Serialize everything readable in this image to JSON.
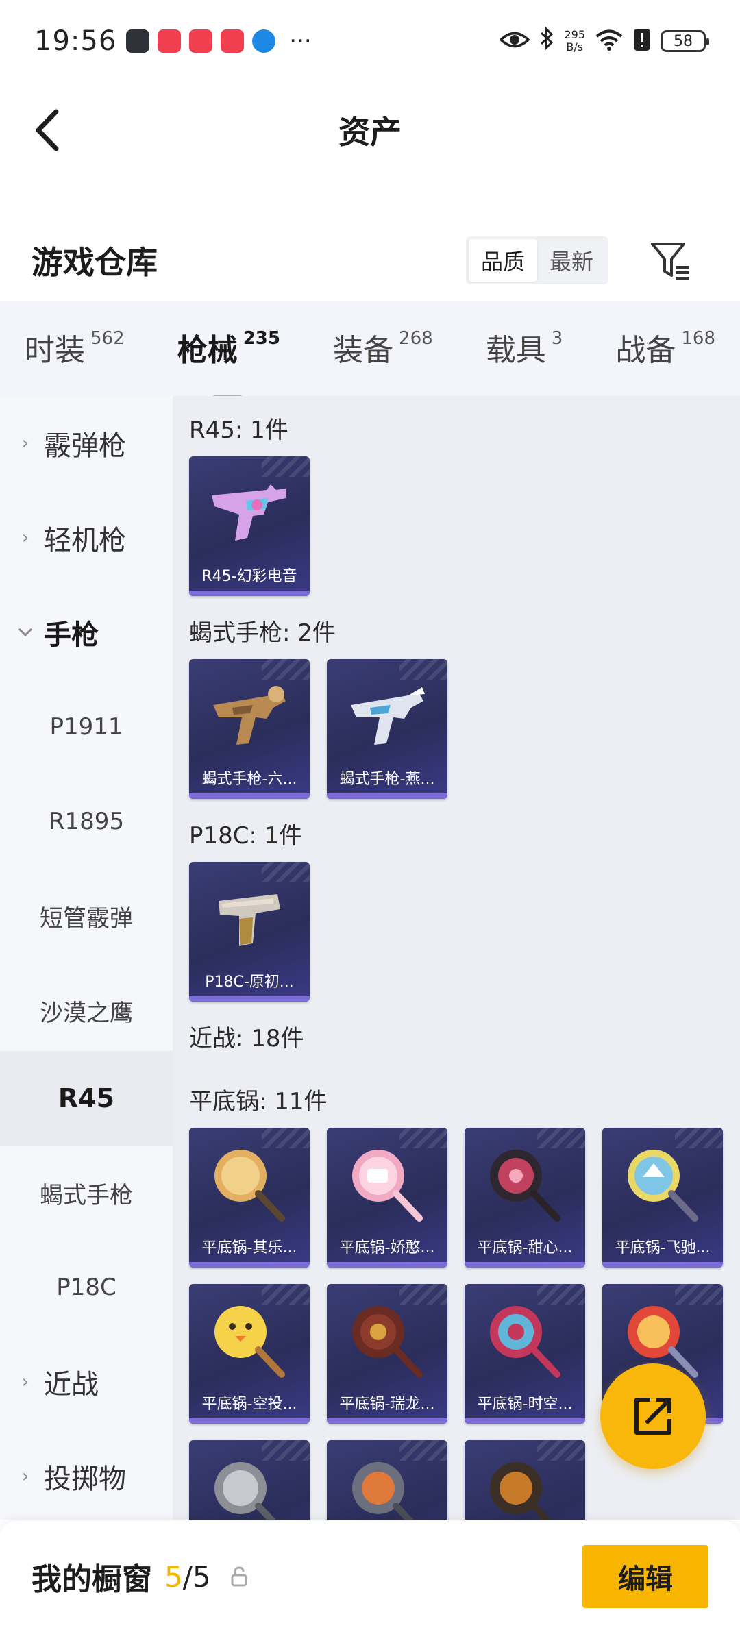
{
  "status_bar": {
    "time": "19:56",
    "more": "···",
    "net_rate_value": "295",
    "net_rate_unit": "B/s",
    "battery": "58"
  },
  "header": {
    "title": "资产"
  },
  "warehouse": {
    "title": "游戏仓库",
    "sort_options": [
      "品质",
      "最新"
    ],
    "active_sort": "品质"
  },
  "category_tabs": [
    {
      "name": "时装",
      "count": "562"
    },
    {
      "name": "枪械",
      "count": "235"
    },
    {
      "name": "装备",
      "count": "268"
    },
    {
      "name": "载具",
      "count": "3"
    },
    {
      "name": "战备",
      "count": "168"
    }
  ],
  "active_category": "枪械",
  "sidebar": {
    "items": [
      {
        "label": "霰弹枪",
        "type": "group"
      },
      {
        "label": "轻机枪",
        "type": "group"
      },
      {
        "label": "手枪",
        "type": "group",
        "expanded": true
      },
      {
        "label": "P1911",
        "type": "sub"
      },
      {
        "label": "R1895",
        "type": "sub"
      },
      {
        "label": "短管霰弹",
        "type": "sub"
      },
      {
        "label": "沙漠之鹰",
        "type": "sub"
      },
      {
        "label": "R45",
        "type": "sub",
        "active": true
      },
      {
        "label": "蝎式手枪",
        "type": "sub"
      },
      {
        "label": "P18C",
        "type": "sub"
      },
      {
        "label": "近战",
        "type": "group"
      },
      {
        "label": "投掷物",
        "type": "group"
      }
    ]
  },
  "sections": [
    {
      "title": "R45: 1件",
      "items": [
        "R45-幻彩电音"
      ]
    },
    {
      "title": "蝎式手枪: 2件",
      "items": [
        "蝎式手枪-六...",
        "蝎式手枪-燕..."
      ]
    },
    {
      "title": "P18C: 1件",
      "items": [
        "P18C-原初..."
      ]
    },
    {
      "title": "近战: 18件",
      "items": []
    },
    {
      "title": "平底锅: 11件",
      "items": [
        "平底锅-其乐...",
        "平底锅-娇憨...",
        "平底锅-甜心...",
        "平底锅-飞驰...",
        "平底锅-空投...",
        "平底锅-瑞龙...",
        "平底锅-时空...",
        "",
        "",
        "",
        ""
      ]
    }
  ],
  "bottom_bar": {
    "label": "我的橱窗",
    "current": "5",
    "total": "/5",
    "edit_label": "编辑"
  },
  "colors": {
    "accent": "#f7b500",
    "card_bg": "#2b2d5a",
    "card_bar": "#7d6bd8",
    "main_bg": "#eceef3",
    "sidebar_bg": "#f5f7fb"
  }
}
